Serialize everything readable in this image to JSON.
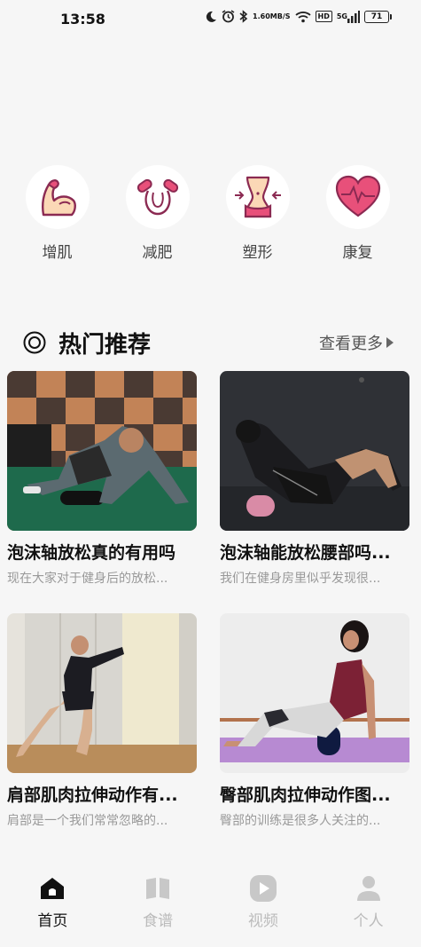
{
  "status_bar": {
    "time": "13:58",
    "network_speed_value": "1.60",
    "network_speed_unit": "MB/S",
    "hd_label": "HD",
    "signal_label": "5G",
    "battery_level": "71",
    "icons": [
      "moon-icon",
      "alarm-icon",
      "bluetooth-icon",
      "wifi-icon",
      "signal-icon",
      "battery-icon"
    ]
  },
  "categories": [
    {
      "label": "增肌",
      "icon": "muscle-arm-icon"
    },
    {
      "label": "减肥",
      "icon": "jump-rope-icon"
    },
    {
      "label": "塑形",
      "icon": "waist-shape-icon"
    },
    {
      "label": "康复",
      "icon": "heart-pulse-icon"
    }
  ],
  "section": {
    "title": "热门推荐",
    "more_label": "查看更多"
  },
  "articles": [
    {
      "title": "泡沫轴放松真的有用吗",
      "desc": "现在大家对于健身后的放松..."
    },
    {
      "title": "泡沫轴能放松腰部吗...",
      "desc": "我们在健身房里似乎发现很..."
    },
    {
      "title": "肩部肌肉拉伸动作有...",
      "desc": "肩部是一个我们常常忽略的..."
    },
    {
      "title": "臀部肌肉拉伸动作图...",
      "desc": "臀部的训练是很多人关注的..."
    }
  ],
  "tabs": [
    {
      "label": "首页",
      "active": true,
      "icon": "home-icon"
    },
    {
      "label": "食谱",
      "active": false,
      "icon": "book-icon"
    },
    {
      "label": "视频",
      "active": false,
      "icon": "play-icon"
    },
    {
      "label": "个人",
      "active": false,
      "icon": "person-icon"
    }
  ],
  "colors": {
    "accent_pink": "#e8507a",
    "active_tab": "#111111",
    "inactive_tab": "#bbbbbb"
  }
}
